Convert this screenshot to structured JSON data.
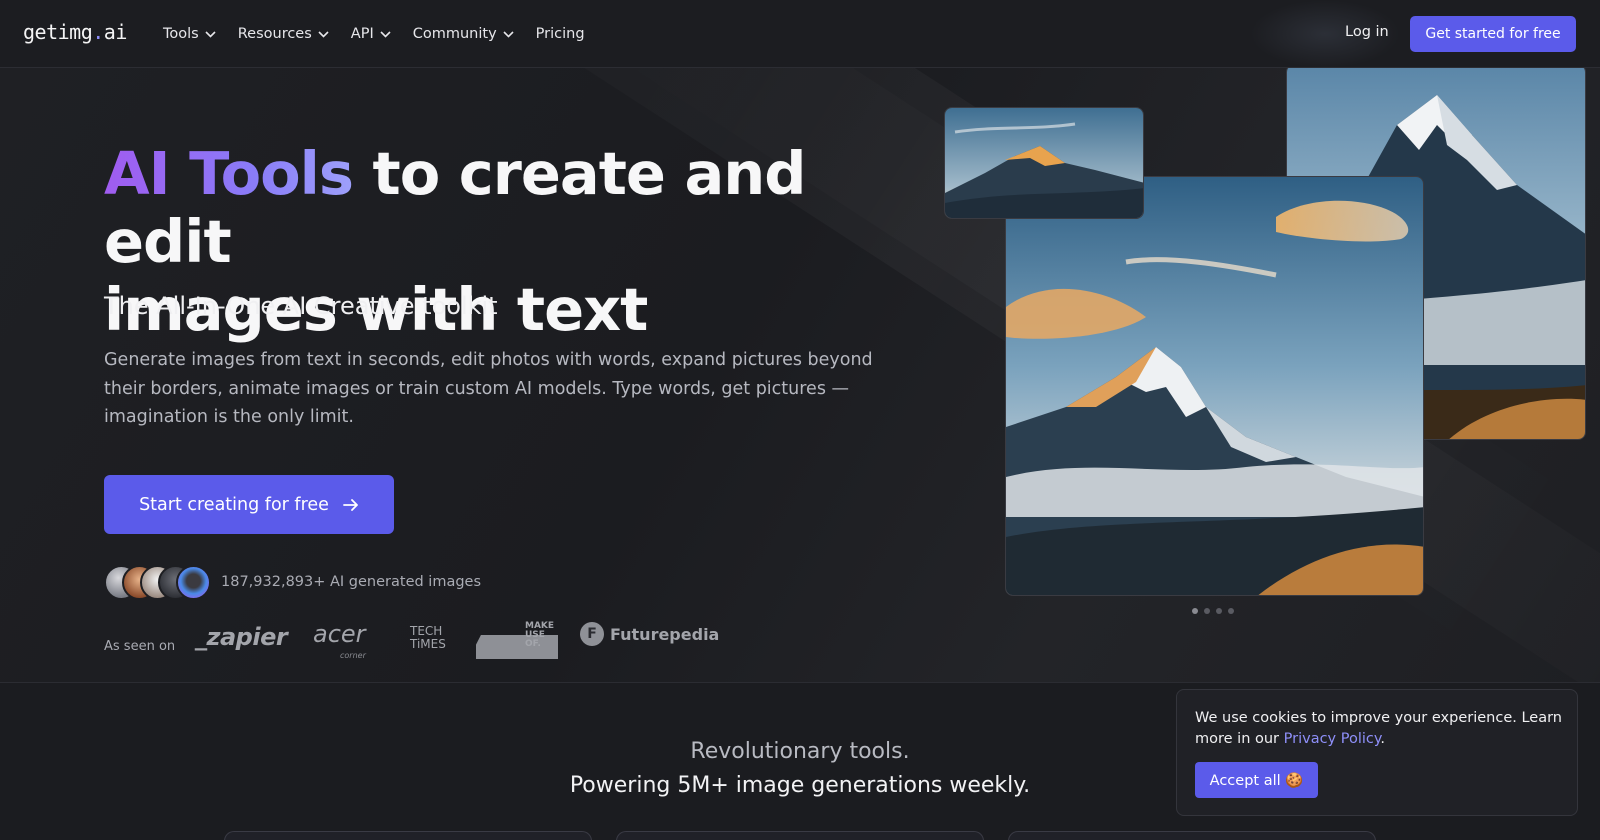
{
  "header": {
    "logo_main": "getimg",
    "logo_dot": ".",
    "logo_suffix": "ai",
    "nav": [
      {
        "label": "Tools",
        "dropdown": true
      },
      {
        "label": "Resources",
        "dropdown": true
      },
      {
        "label": "API",
        "dropdown": true
      },
      {
        "label": "Community",
        "dropdown": true
      },
      {
        "label": "Pricing",
        "dropdown": false
      }
    ],
    "login_label": "Log in",
    "cta_label": "Get started for free"
  },
  "hero": {
    "title_highlight": "AI Tools",
    "title_rest_line1": " to create and edit",
    "title_line2": "images with text",
    "subtitle": "The All-In-One AI Creative toolkit",
    "description": "Generate images from text in seconds, edit photos with words, expand pictures beyond their borders, animate images or train custom AI models. Type words, get pictures — imagination is the only limit.",
    "cta_label": "Start creating for free",
    "image_count_text": "187,932,893+ AI generated images",
    "seen_on_label": "As seen on",
    "press_logos": {
      "zapier": "_zapier",
      "acer": "acer",
      "acer_sub": "corner",
      "techtimes_line1": "TECH",
      "techtimes_line2": "TiMES",
      "muo_line1": "MAKE",
      "muo_line2": "USE",
      "muo_line3": "OF.",
      "futurepedia_letter": "F",
      "futurepedia": "Futurepedia"
    },
    "carousel_active_index": 0,
    "carousel_count": 4
  },
  "lower": {
    "line1": "Revolutionary tools.",
    "line2": "Powering 5M+ image generations weekly."
  },
  "cookie": {
    "text_before": "We use cookies to improve your experience. Learn more in our ",
    "link_label": "Privacy Policy",
    "text_after": ".",
    "button_label": "Accept all 🍪"
  },
  "colors": {
    "accent": "#5b5bea",
    "background": "#1c1c20",
    "link": "#8e8ff8"
  }
}
